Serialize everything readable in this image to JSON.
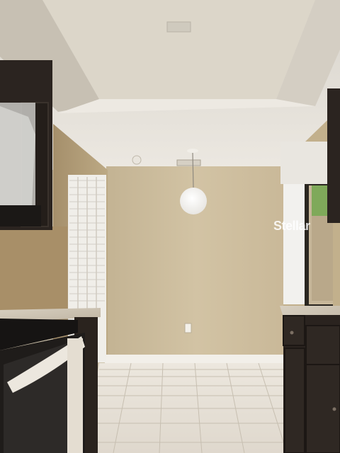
{
  "watermark": {
    "text": "Stellar"
  }
}
